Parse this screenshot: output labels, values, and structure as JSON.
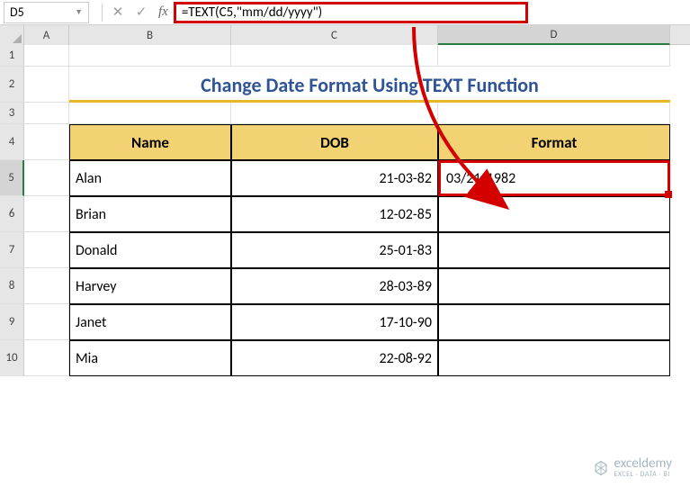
{
  "nameBox": "D5",
  "formula": "=TEXT(C5,\"mm/dd/yyyy\")",
  "columns": [
    "A",
    "B",
    "C",
    "D"
  ],
  "rows": [
    "1",
    "2",
    "3",
    "4",
    "5",
    "6",
    "7",
    "8",
    "9",
    "10"
  ],
  "title": "Change Date Format Using TEXT Function",
  "headers": {
    "name": "Name",
    "dob": "DOB",
    "format": "Format"
  },
  "data": [
    {
      "name": "Alan",
      "dob": "21-03-82",
      "format": "03/21/1982"
    },
    {
      "name": "Brian",
      "dob": "12-02-85",
      "format": ""
    },
    {
      "name": "Donald",
      "dob": "25-01-83",
      "format": ""
    },
    {
      "name": "Harvey",
      "dob": "28-03-89",
      "format": ""
    },
    {
      "name": "Janet",
      "dob": "17-10-90",
      "format": ""
    },
    {
      "name": "Mia",
      "dob": "22-08-92",
      "format": ""
    }
  ],
  "watermark": {
    "brand": "exceldemy",
    "tag": "EXCEL · DATA · BI"
  }
}
